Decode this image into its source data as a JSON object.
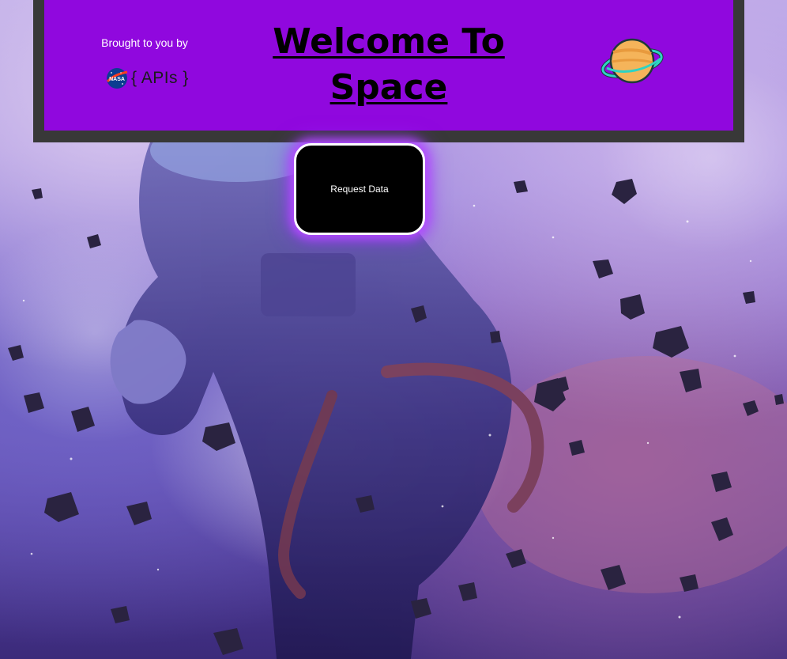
{
  "header": {
    "brought_by": "Brought to you by",
    "api_label": "{ APIs }",
    "nasa_logo_text": "NASA",
    "title": "Welcome To Space",
    "planet_icon": "ringed-planet-icon"
  },
  "actions": {
    "request_label": "Request Data"
  },
  "background": {
    "scene": "astronaut-in-asteroid-field"
  },
  "colors": {
    "header_purple": "#9008de",
    "header_frame": "#383838",
    "button_bg": "#000000",
    "button_glow": "#b44cff",
    "planet_body": "#f5b45a",
    "planet_ring": "#2fd3c3"
  }
}
